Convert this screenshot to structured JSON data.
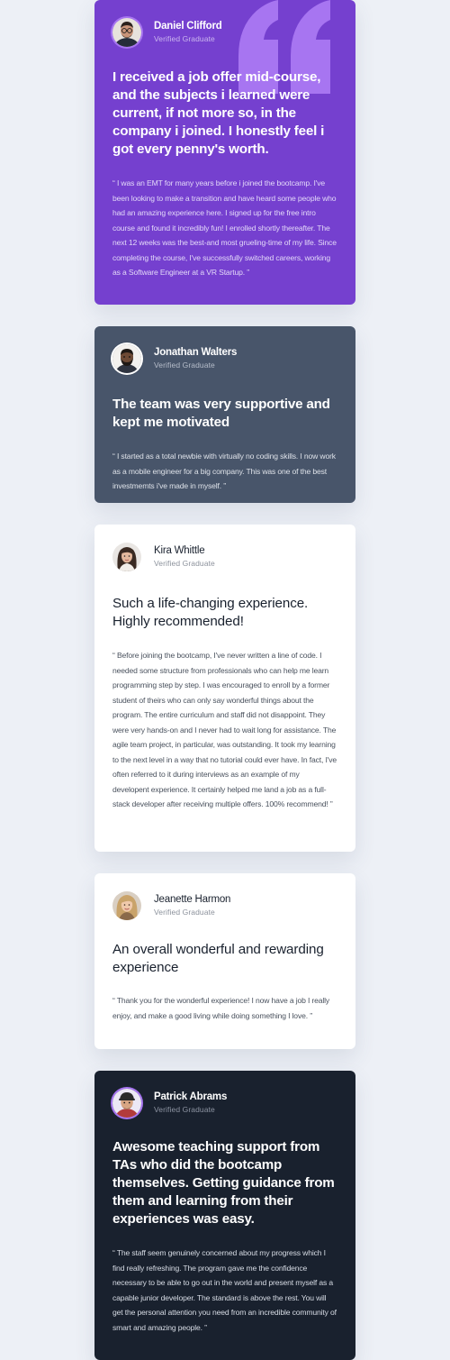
{
  "colors": {
    "page_background": "#edf0f6",
    "purple_card": "#7540cf",
    "slate_card": "#48556a",
    "white_card": "#ffffff",
    "dark_card": "#19212e",
    "quote_mark": "#a775f1"
  },
  "testimonials": [
    {
      "name": "Daniel Clifford",
      "role": "Verified Graduate",
      "avatar_icon": "man-with-glasses-avatar",
      "headline": "I received a job offer mid-course, and the subjects i learned were current, if not more so, in the company i joined. I honestly feel i got every penny's worth.",
      "body": "“ I was an EMT for many years before i joined the bootcamp. I've been looking to make a transition and have heard some people who had an amazing experience here. I signed up for the free intro course and found it incredibly fun! I enrolled shortly thereafter. The next 12 weeks was the best-and most grueling-time of my life. Since completing the course, I've successfully switched careers, working as a Software Engineer at a VR Startup. ”"
    },
    {
      "name": "Jonathan Walters",
      "role": "Verified Graduate",
      "avatar_icon": "bearded-man-avatar",
      "headline": "The team was very supportive and kept me motivated",
      "body": "“ I started as a total newbie with virtually no coding skills. I now work as a mobile engineer for a big company. This was one of the best investmemts i've made in myself. ”"
    },
    {
      "name": "Kira Whittle",
      "role": "Verified Graduate",
      "avatar_icon": "woman-dark-hair-avatar",
      "headline": "Such a life-changing experience. Highly recommended!",
      "body": "“ Before joining the bootcamp, I've never written a line of code. I needed some structure from professionals who can help me learn programming step by step. I was encouraged to enroll by a former student of theirs who can only say wonderful things about the program. The entire curriculum and staff did not disappoint. They were very hands-on and I never had to wait long for assistance. The agile team project, in particular, was outstanding. It took my learning to the next level in a way that no tutorial could ever have. In fact, I've often referred to it during interviews as an example of my developent experience. It certainly helped me land a job as a full-stack developer after receiving multiple offers. 100% recommend! ”"
    },
    {
      "name": "Jeanette Harmon",
      "role": "Verified Graduate",
      "avatar_icon": "woman-blonde-avatar",
      "headline": "An overall wonderful and rewarding experience",
      "body": "“ Thank you for the wonderful experience! I now have a job I really enjoy, and make a good living while doing something I love. ”"
    },
    {
      "name": "Patrick Abrams",
      "role": "Verified Graduate",
      "avatar_icon": "man-with-cap-avatar",
      "headline": "Awesome teaching support from TAs who did the bootcamp themselves. Getting guidance from them and learning from their experiences was easy.",
      "body": "“ The staff seem genuinely concerned about my progress which I find really refreshing. The program gave me the confidence necessary to be able to go out in the world and present myself as a capable junior developer. The standard is above the rest. You will get the personal attention you need from an incredible community of smart and amazing people. ”"
    }
  ]
}
